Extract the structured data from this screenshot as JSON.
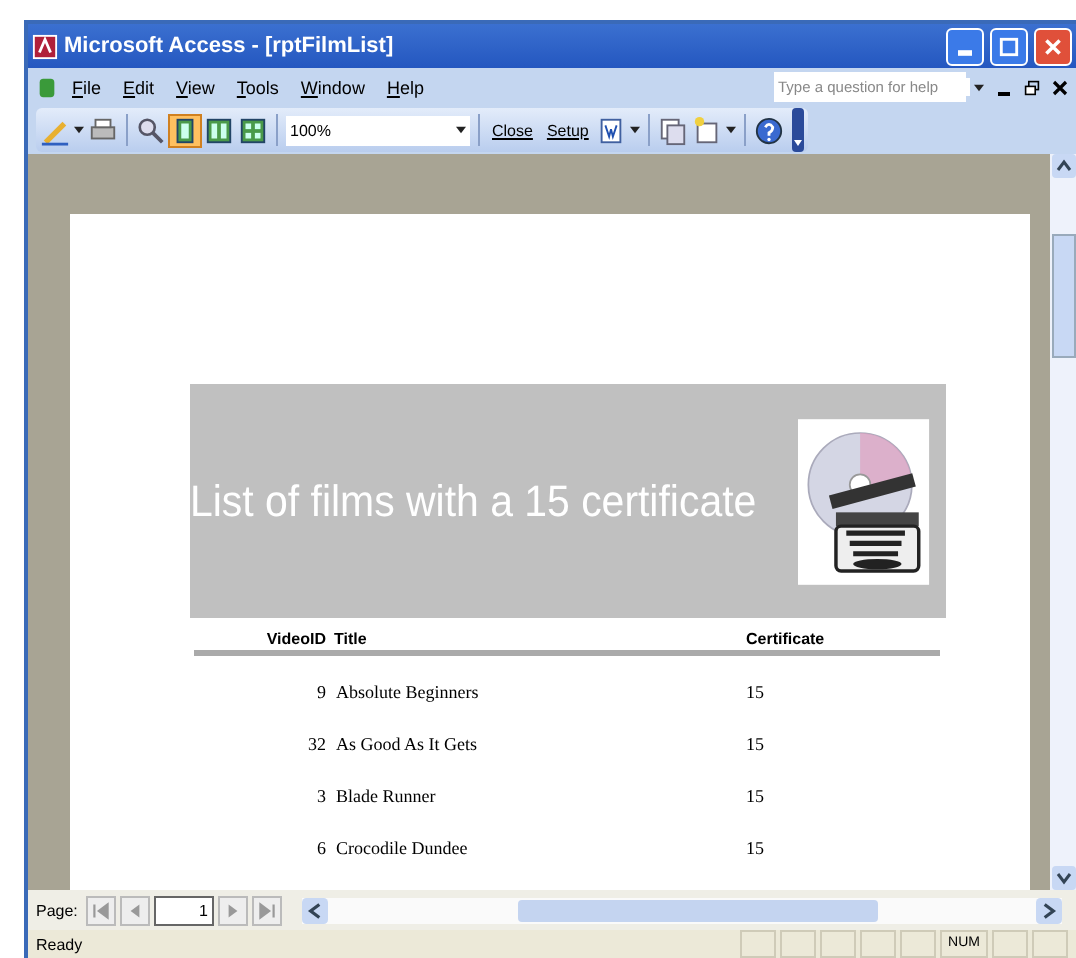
{
  "window": {
    "title": "Microsoft Access - [rptFilmList]"
  },
  "menu": [
    "File",
    "Edit",
    "View",
    "Tools",
    "Window",
    "Help"
  ],
  "help_search": {
    "placeholder": "Type a question for help"
  },
  "toolbar": {
    "zoom": "100%",
    "buttons": [
      "Close",
      "Setup"
    ]
  },
  "report": {
    "title": "List of films with a 15 certificate",
    "columns": [
      "VideoID",
      "Title",
      "Certificate"
    ],
    "rows": [
      {
        "id": "9",
        "title": "Absolute Beginners",
        "certificate": "15"
      },
      {
        "id": "32",
        "title": "As Good As It Gets",
        "certificate": "15"
      },
      {
        "id": "3",
        "title": "Blade Runner",
        "certificate": "15"
      },
      {
        "id": "6",
        "title": "Crocodile Dundee",
        "certificate": "15"
      }
    ]
  },
  "navigation": {
    "label": "Page:",
    "page": "1"
  },
  "status_bar": {
    "text": "Ready",
    "indicators": [
      "NUM"
    ]
  }
}
